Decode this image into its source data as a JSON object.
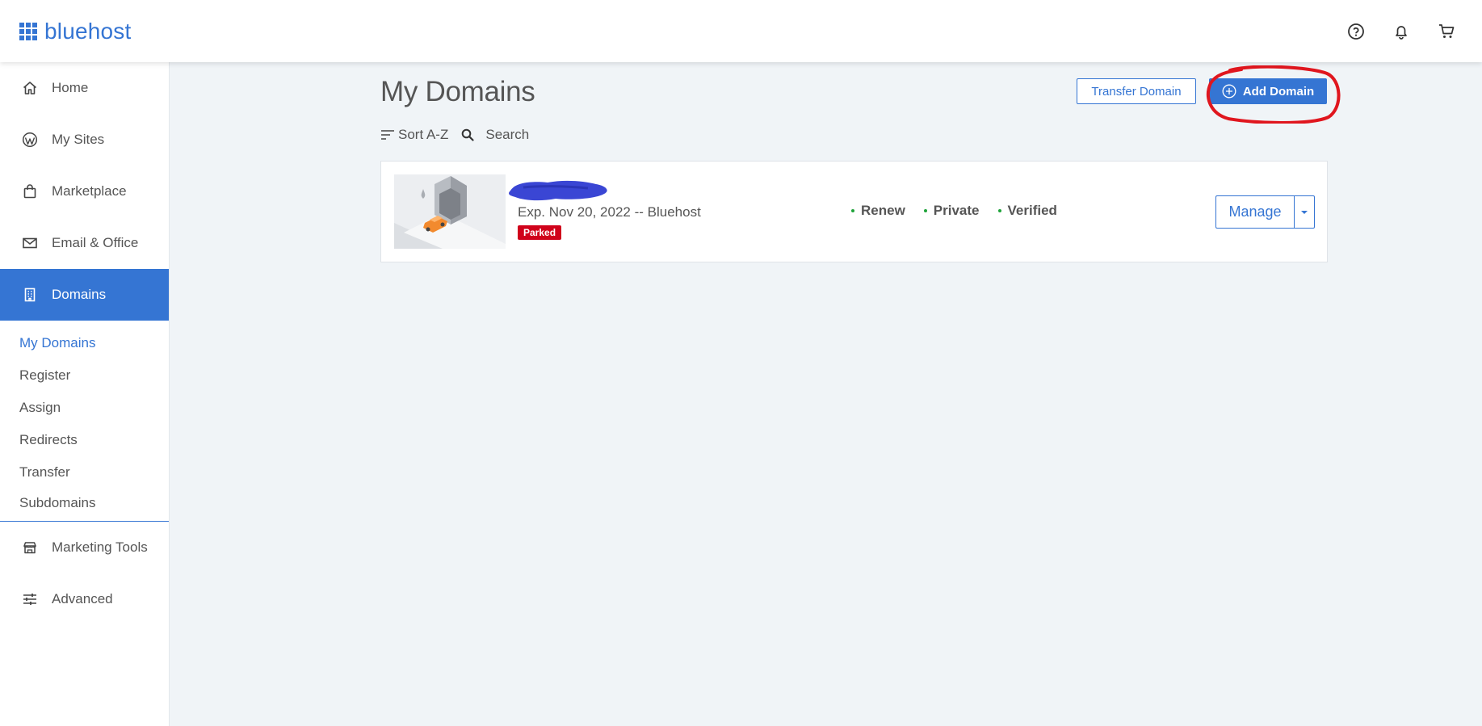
{
  "brand": {
    "name": "bluehost",
    "color": "#3575d3"
  },
  "header": {
    "icons": [
      "help-icon",
      "bell-icon",
      "cart-icon"
    ]
  },
  "sidebar": {
    "items": [
      {
        "label": "Home",
        "icon": "home-icon"
      },
      {
        "label": "My Sites",
        "icon": "wordpress-icon"
      },
      {
        "label": "Marketplace",
        "icon": "shopping-bag-icon"
      },
      {
        "label": "Email & Office",
        "icon": "envelope-icon"
      },
      {
        "label": "Domains",
        "icon": "building-icon",
        "active": true
      },
      {
        "label": "Marketing Tools",
        "icon": "storefront-icon"
      },
      {
        "label": "Advanced",
        "icon": "sliders-icon"
      }
    ],
    "subitems": [
      {
        "label": "My Domains",
        "current": true
      },
      {
        "label": "Register"
      },
      {
        "label": "Assign"
      },
      {
        "label": "Redirects"
      },
      {
        "label": "Transfer"
      },
      {
        "label": "Subdomains"
      }
    ]
  },
  "main": {
    "title": "My Domains",
    "transfer_label": "Transfer Domain",
    "add_label": "Add Domain",
    "sort_label": "Sort A-Z",
    "search_label": "Search"
  },
  "domain_card": {
    "expiry": "Exp. Nov 20, 2022 -- Bluehost",
    "badge": "Parked",
    "badge_color": "#d0021b",
    "statuses": [
      "Renew",
      "Private",
      "Verified"
    ],
    "status_dot_color": "#1fa33a",
    "manage_label": "Manage"
  },
  "annotation_color": "#e0161e"
}
